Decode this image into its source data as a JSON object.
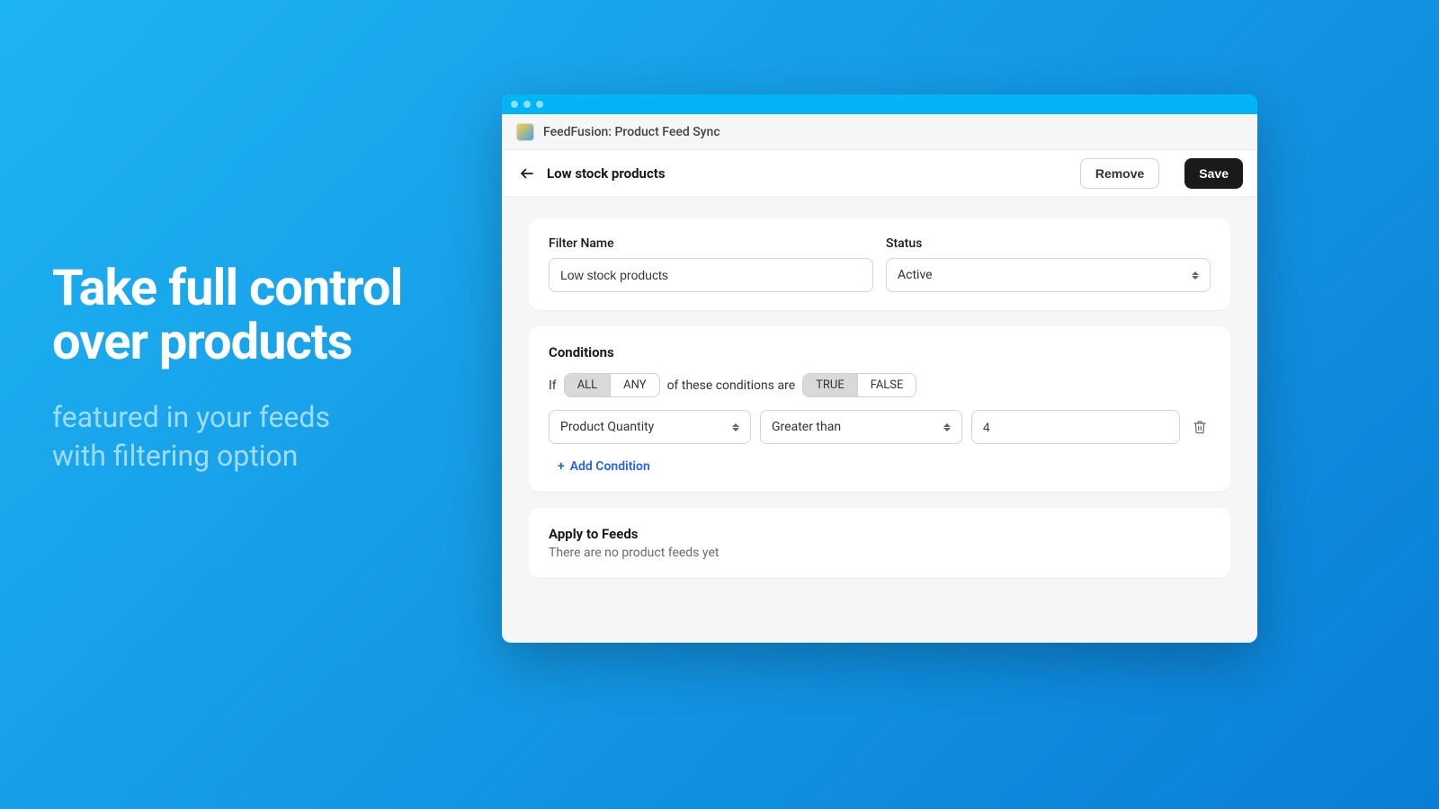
{
  "promo": {
    "title_line1": "Take full control",
    "title_line2": "over products",
    "sub_line1": "featured in your feeds",
    "sub_line2": "with filtering option"
  },
  "app": {
    "title": "FeedFusion: Product Feed Sync"
  },
  "page": {
    "title": "Low stock products",
    "remove": "Remove",
    "save": "Save"
  },
  "filter_card": {
    "name_label": "Filter Name",
    "name_value": "Low stock products",
    "status_label": "Status",
    "status_value": "Active"
  },
  "conditions": {
    "title": "Conditions",
    "if_label": "If",
    "all": "ALL",
    "any": "ANY",
    "of_text": "of these conditions are",
    "true": "TRUE",
    "false": "FALSE",
    "selected_scope": "ALL",
    "selected_bool": "TRUE",
    "row": {
      "attribute": "Product Quantity",
      "operator": "Greater than",
      "value": "4"
    },
    "add_label": "Add Condition"
  },
  "feeds": {
    "title": "Apply to Feeds",
    "empty": "There are no product feeds yet"
  }
}
